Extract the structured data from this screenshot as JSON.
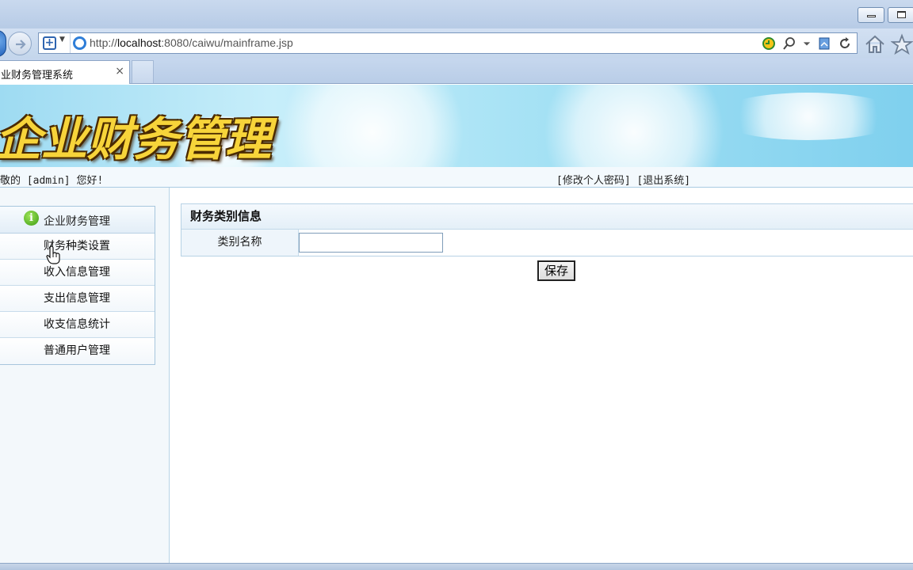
{
  "browser": {
    "url_prefix": "http://",
    "url_host": "localhost",
    "url_rest": ":8080/caiwu/mainframe.jsp",
    "tab_title": "业财务管理系统",
    "tab_close": "×"
  },
  "page": {
    "banner_title": "企业财务管理",
    "welcome_text": "敬的 [admin] 您好!",
    "links": {
      "change_password": "[修改个人密码]",
      "logout": "[退出系统]"
    }
  },
  "sidebar": {
    "header": "企业财务管理",
    "info_glyph": "i",
    "items": [
      {
        "label": "财务种类设置"
      },
      {
        "label": "收入信息管理"
      },
      {
        "label": "支出信息管理"
      },
      {
        "label": "收支信息统计"
      },
      {
        "label": "普通用户管理"
      }
    ]
  },
  "form": {
    "title": "财务类别信息",
    "field_label": "类别名称",
    "field_value": "",
    "save_label": "保存"
  },
  "colors": {
    "banner_text": "#f7d43a",
    "accent_border": "#b7d2e5"
  }
}
